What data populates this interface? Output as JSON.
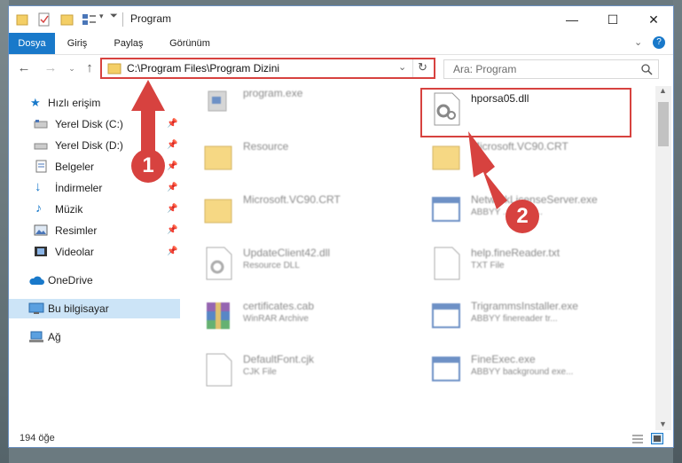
{
  "window": {
    "title": "Program"
  },
  "ribbon": {
    "tabs": [
      "Dosya",
      "Giriş",
      "Paylaş",
      "Görünüm"
    ]
  },
  "address": {
    "path": "C:\\Program Files\\Program Dizini"
  },
  "search": {
    "placeholder": "Ara: Program"
  },
  "sidebar": {
    "items": [
      {
        "label": "Hızlı erişim"
      },
      {
        "label": "Yerel Disk (C:)"
      },
      {
        "label": "Yerel Disk (D:)"
      },
      {
        "label": "Belgeler"
      },
      {
        "label": "İndirmeler"
      },
      {
        "label": "Müzik"
      },
      {
        "label": "Resimler"
      },
      {
        "label": "Videolar"
      },
      {
        "label": "OneDrive"
      },
      {
        "label": "Bu bilgisayar"
      },
      {
        "label": "Ağ"
      }
    ]
  },
  "files": [
    {
      "name": "program.exe",
      "sub": ""
    },
    {
      "name": "hporsa05.dll",
      "sub": ""
    },
    {
      "name": "Resource",
      "sub": ""
    },
    {
      "name": "Microsoft.VC90.CRT",
      "sub": ""
    },
    {
      "name": "Microsoft.VC90.CRT",
      "sub": ""
    },
    {
      "name": "NetworkLicenseServer.exe",
      "sub": "ABBYY ... licens..."
    },
    {
      "name": "UpdateClient42.dll",
      "sub": "Resource DLL"
    },
    {
      "name": "help.fineReader.txt",
      "sub": "TXT File"
    },
    {
      "name": "certificates.cab",
      "sub": "WinRAR Archive"
    },
    {
      "name": "TrigrammsInstaller.exe",
      "sub": "ABBYY finereader tr..."
    },
    {
      "name": "DefaultFont.cjk",
      "sub": "CJK File"
    },
    {
      "name": "FineExec.exe",
      "sub": "ABBYY background exe..."
    }
  ],
  "status": {
    "count": "194 öğe"
  },
  "annotations": {
    "one": "1",
    "two": "2"
  },
  "colors": {
    "accent": "#1979ca",
    "highlight": "#d7423f"
  }
}
